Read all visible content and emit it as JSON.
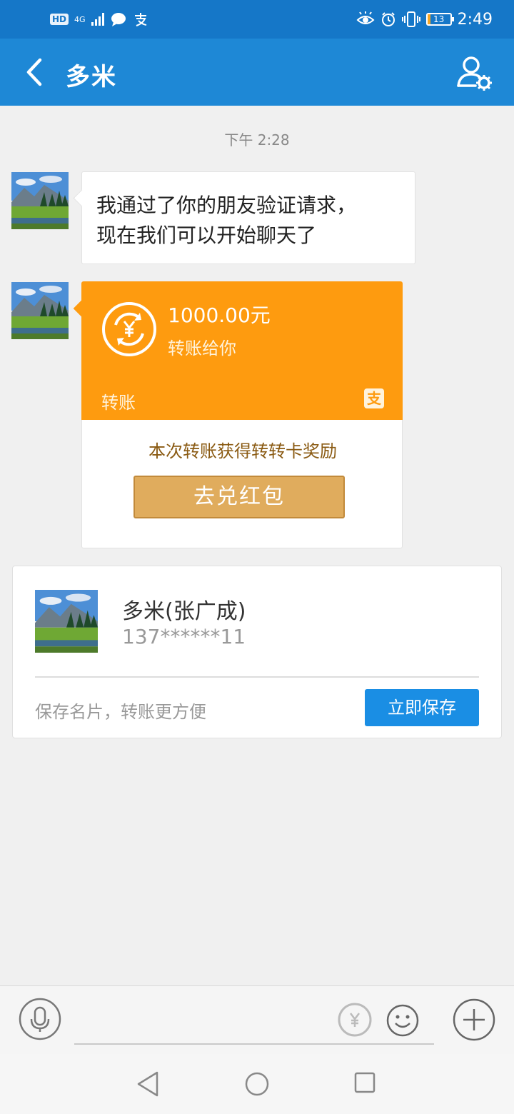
{
  "status_bar": {
    "hd": "HD",
    "network": "4G",
    "time": "2:49",
    "battery_level": "13",
    "battery_fraction": 0.13
  },
  "header": {
    "title": "多米",
    "back_icon": "chevron-left-icon",
    "settings_icon": "user-settings-icon"
  },
  "chat": {
    "timestamp": "下午 2:28",
    "messages": [
      {
        "type": "text",
        "lines": [
          "我通过了你的朋友验证请求，",
          "现在我们可以开始聊天了"
        ]
      },
      {
        "type": "transfer",
        "amount": "1000.00元",
        "description": "转账给你",
        "label": "转账",
        "reward_text": "本次转账获得转转卡奖励",
        "button_label": "去兑红包"
      }
    ]
  },
  "contact_card": {
    "name": "多米(张广成)",
    "phone": "137******11",
    "hint": "保存名片，转账更方便",
    "save_label": "立即保存"
  },
  "input_bar": {
    "voice_icon": "microphone-icon",
    "transfer_icon": "yuan-transfer-icon",
    "emoji_icon": "smiley-icon",
    "plus_icon": "plus-circle-icon"
  },
  "colors": {
    "header_blue": "#1e88d6",
    "status_blue": "#1577c8",
    "transfer_orange": "#fe9b0f",
    "redeem_gold": "#e0ac5d",
    "save_blue": "#1a8ee4"
  }
}
